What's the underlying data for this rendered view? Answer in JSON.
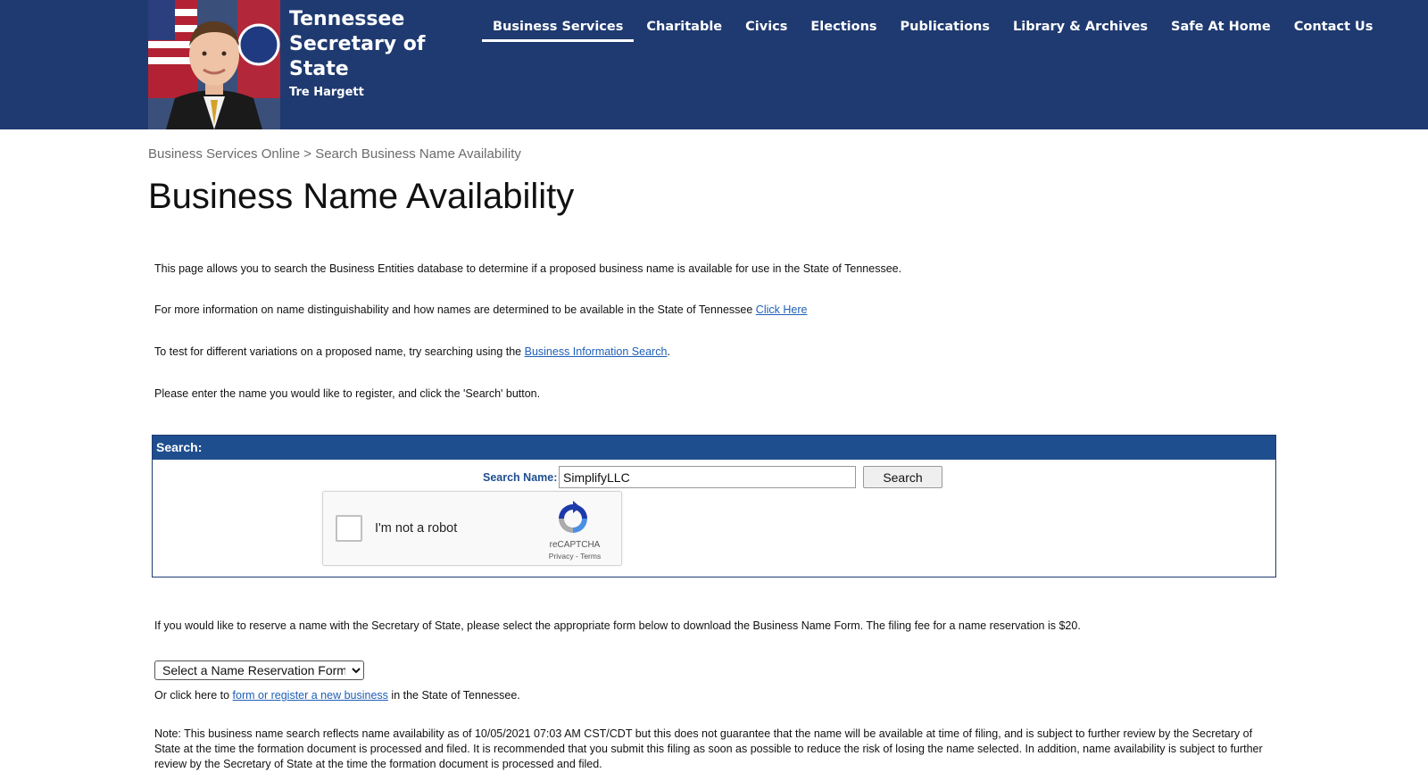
{
  "header": {
    "title": "Tennessee Secretary of State",
    "subtitle": "Tre Hargett",
    "nav": [
      {
        "label": "Business Services",
        "active": true
      },
      {
        "label": "Charitable",
        "active": false
      },
      {
        "label": "Civics",
        "active": false
      },
      {
        "label": "Elections",
        "active": false
      },
      {
        "label": "Publications",
        "active": false
      },
      {
        "label": "Library & Archives",
        "active": false
      },
      {
        "label": "Safe At Home",
        "active": false
      },
      {
        "label": "Contact Us",
        "active": false
      }
    ]
  },
  "breadcrumb": {
    "root": "Business Services Online",
    "separator": ">",
    "current": "Search Business Name Availability"
  },
  "page_title": "Business Name Availability",
  "intro": {
    "p1": "This page allows you to search the Business Entities database to determine if a proposed business name is available for use in the State of Tennessee.",
    "p2_text": "For more information on name distinguishability and how names are determined to be available in the State of Tennessee",
    "p2_link": "Click Here",
    "p3_text": "To test for different variations on a proposed name, try searching using the",
    "p3_link": "Business Information Search",
    "p3_end": ".",
    "p4": "Please enter the name you would like to register, and click the 'Search' button."
  },
  "search": {
    "header": "Search:",
    "label": "Search Name:",
    "value": "SimplifyLLC",
    "button": "Search"
  },
  "recaptcha": {
    "label": "I'm not a robot",
    "brand": "reCAPTCHA",
    "terms": "Privacy - Terms"
  },
  "reserve": {
    "text": "If you would like to reserve a name with the Secretary of State, please select the appropriate form below to download the Business Name Form. The filing fee for a name reservation is $20.",
    "select_value": "Select a Name Reservation Form",
    "or_text": "Or click here to",
    "or_link": "form or register a new business",
    "or_end": "in the State of Tennessee."
  },
  "note": "Note: This business name search reflects name availability as of 10/05/2021 07:03 AM CST/CDT but this does not guarantee that the name will be available at time of filing, and is subject to further review by the Secretary of State at the time the formation document is processed and filed. It is recommended that you submit this filing as soon as possible to reduce the risk of losing the name selected. In addition, name availability is subject to further review by the Secretary of State at the time the formation document is processed and filed.",
  "colors": {
    "header_bg": "#1f3a70",
    "panel_header_bg": "#1f4e8f",
    "link": "#1f5fb8"
  }
}
